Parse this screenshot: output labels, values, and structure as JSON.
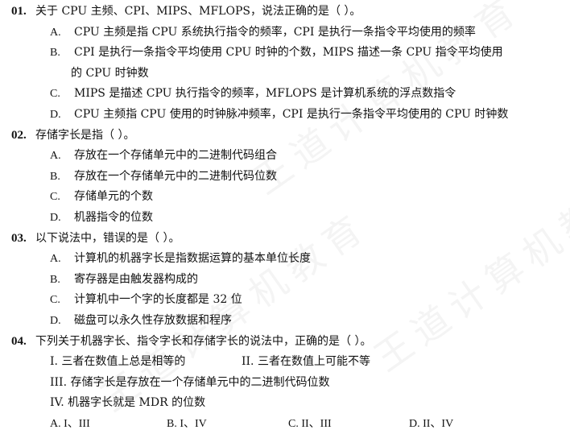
{
  "questions": [
    {
      "number": "01.",
      "stem": "关于 CPU 主频、CPI、MIPS、MFLOPS，说法正确的是（    ）。",
      "options": [
        {
          "label": "A.",
          "lines": [
            "CPU 主频是指 CPU 系统执行指令的频率，CPI 是执行一条指令平均使用的频率"
          ]
        },
        {
          "label": "B.",
          "lines": [
            "CPI 是执行一条指令平均使用 CPU 时钟的个数，MIPS 描述一条 CPU 指令平均使用",
            "的 CPU 时钟数"
          ]
        },
        {
          "label": "C.",
          "lines": [
            "MIPS 是描述 CPU 执行指令的频率，MFLOPS 是计算机系统的浮点数指令"
          ]
        },
        {
          "label": "D.",
          "lines": [
            "CPU 主频指 CPU 使用的时钟脉冲频率，CPI 是执行一条指令平均使用的 CPU 时钟数"
          ]
        }
      ]
    },
    {
      "number": "02.",
      "stem": "存储字长是指（    ）。",
      "options": [
        {
          "label": "A.",
          "lines": [
            "存放在一个存储单元中的二进制代码组合"
          ]
        },
        {
          "label": "B.",
          "lines": [
            "存放在一个存储单元中的二进制代码位数"
          ]
        },
        {
          "label": "C.",
          "lines": [
            "存储单元的个数"
          ]
        },
        {
          "label": "D.",
          "lines": [
            "机器指令的位数"
          ]
        }
      ]
    },
    {
      "number": "03.",
      "stem": "以下说法中，错误的是（    ）。",
      "options": [
        {
          "label": "A.",
          "lines": [
            "计算机的机器字长是指数据运算的基本单位长度"
          ]
        },
        {
          "label": "B.",
          "lines": [
            "寄存器是由触发器构成的"
          ]
        },
        {
          "label": "C.",
          "lines": [
            "计算机中一个字的长度都是 32 位"
          ]
        },
        {
          "label": "D.",
          "lines": [
            "磁盘可以永久性存放数据和程序"
          ]
        }
      ]
    }
  ],
  "q4": {
    "number": "04.",
    "stem": "下列关于机器字长、指令字长和存储字长的说法中，正确的是（    ）。",
    "statements": [
      "I.  三者在数值上总是相等的",
      "II.  三者在数值上可能不等",
      "III.  存储字长是存放在一个存储单元中的二进制代码位数",
      "IV.  机器字长就是 MDR 的位数"
    ],
    "choices": [
      "A.  I、III",
      "B.  I、IV",
      "C.  II、III",
      "D.  II、IV"
    ]
  },
  "watermark": [
    "王道计算机教育",
    "王道计算机教育",
    "王道计算机教育"
  ]
}
